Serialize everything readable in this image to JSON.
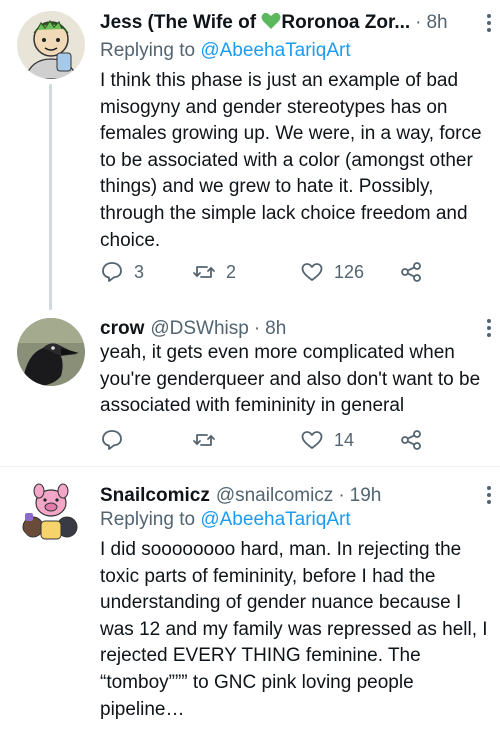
{
  "tweets": [
    {
      "name": "Jess (The Wife of 💚Roronoa Zor...",
      "name_part1": "Jess (The Wife of ",
      "name_part2": "Roronoa Zor...",
      "time": "8h",
      "replying_label": "Replying to ",
      "replying_handle": "@AbeehaTariqArt",
      "text": "I think this phase is just an example of bad misogyny and gender stereotypes has on females growing up. We were, in a way, force to be associated with a color (amongst other things) and we grew to hate it. Possibly, through the simple lack choice freedom and choice.",
      "replies": "3",
      "retweets": "2",
      "likes": "126",
      "avatar_icon": "anime-character-avatar"
    },
    {
      "name": "crow",
      "handle": "@DSWhisp",
      "time": "8h",
      "text": "yeah, it gets even more complicated when you're genderqueer and also don't want to be associated with femininity in general",
      "replies": "",
      "retweets": "",
      "likes": "14",
      "avatar_icon": "crow-bird-avatar"
    },
    {
      "name": "Snailcomicz",
      "handle": "@snailcomicz",
      "time": "19h",
      "replying_label": "Replying to ",
      "replying_handle": "@AbeehaTariqArt",
      "text": "I did soooooooo hard, man. In rejecting the toxic parts of femininity, before I had the understanding of gender nuance because I was 12 and my family was repressed as hell, I rejected EVERY THING feminine. The “tomboy””” to GNC pink loving people pipeline…",
      "avatar_icon": "cartoon-characters-avatar"
    }
  ],
  "colors": {
    "accent": "#1d9bf0",
    "secondary_text": "#536471",
    "heart": "#5cb85c",
    "thread_line": "#cfd9de"
  },
  "icons": [
    "reply-icon",
    "retweet-icon",
    "like-icon",
    "share-icon",
    "more-icon",
    "green-heart-emoji"
  ]
}
